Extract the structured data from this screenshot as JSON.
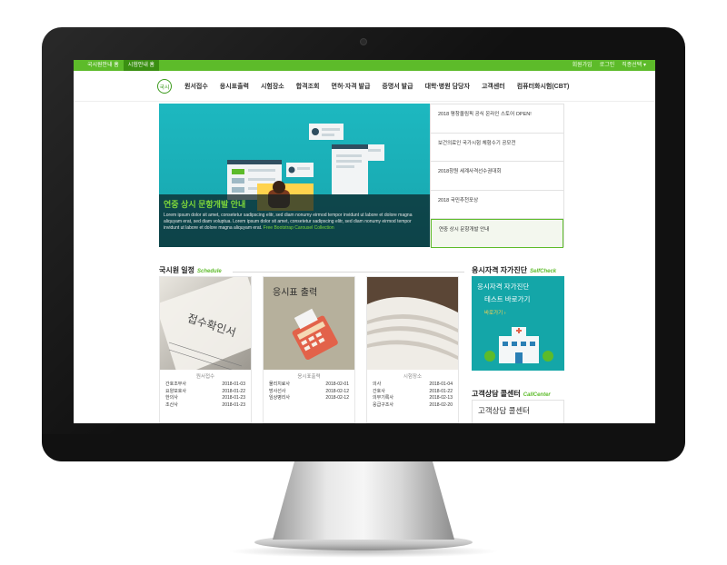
{
  "topbar": {
    "tabs": [
      "국시원안내 홈",
      "시험안내 홈"
    ],
    "links": [
      "회원가입",
      "로그인",
      "직종선택 ▾"
    ]
  },
  "nav": {
    "logo": "국시",
    "items": [
      "원서접수",
      "응시표출력",
      "시험장소",
      "합격조회",
      "면허·자격 발급",
      "증명서 발급",
      "대학·병원 담당자",
      "고객센터",
      "컴퓨터화시험(CBT)"
    ]
  },
  "hero": {
    "title": "연중 상시 문항개발 안내",
    "text": "Lorem ipsum dolor sit amet, consetetur sadipscing elitr, sed diam nonumy eirmod tempor invidunt ut labore et dolore magna aliquyam erat, sed diam voluptua. Lorem ipsum dolor sit amet, consetetur sadipscing elitr, sed diam nonumy eirmod tempor invidunt ut labore et dolore magna aliquyam erat.",
    "link": "Free Bootstrap Carousel Collection"
  },
  "news": [
    "2018 평창올림픽 공식 온라인 스토어 OPEN!",
    "보건의료인 국가시험 체험수기 공모전",
    "2018창원 세계사격선수권대회",
    "2018 국민추천포상",
    "연중 상시 문항개발 안내"
  ],
  "schedule": {
    "title": "국시원 일정",
    "sub": "Schedule",
    "cards": [
      {
        "image_text": "접수확인서",
        "label": "원서접수",
        "rows": [
          [
            "간호조무사",
            "2018-01-03"
          ],
          [
            "요양보호사",
            "2018-01-22"
          ],
          [
            "한의사",
            "2018-01-23"
          ],
          [
            "조산사",
            "2018-01-23"
          ]
        ]
      },
      {
        "image_text": "응시표 출력",
        "label": "응시표출력",
        "rows": [
          [
            "물리치료사",
            "2018-02-01"
          ],
          [
            "방사선사",
            "2018-02-12"
          ],
          [
            "임상병리사",
            "2018-02-12"
          ]
        ]
      },
      {
        "image_text": "",
        "label": "시험장소",
        "rows": [
          [
            "의사",
            "2018-01-04"
          ],
          [
            "간호사",
            "2018-01-22"
          ],
          [
            "의무기록사",
            "2018-02-13"
          ],
          [
            "응급구조사",
            "2018-02-20"
          ]
        ]
      }
    ]
  },
  "selfcheck": {
    "title": "응시자격 자가진단",
    "sub": "SelfCheck",
    "line1": "응시자격 자가진단",
    "line2": "테스트 바로가기",
    "line3": "바로가기 ›"
  },
  "callcenter": {
    "title": "고객상담 콜센터",
    "sub": "CallCenter",
    "text": "고객상담 콜센터"
  },
  "colors": {
    "brand_green": "#5dbb2a",
    "teal": "#14a6a8"
  }
}
